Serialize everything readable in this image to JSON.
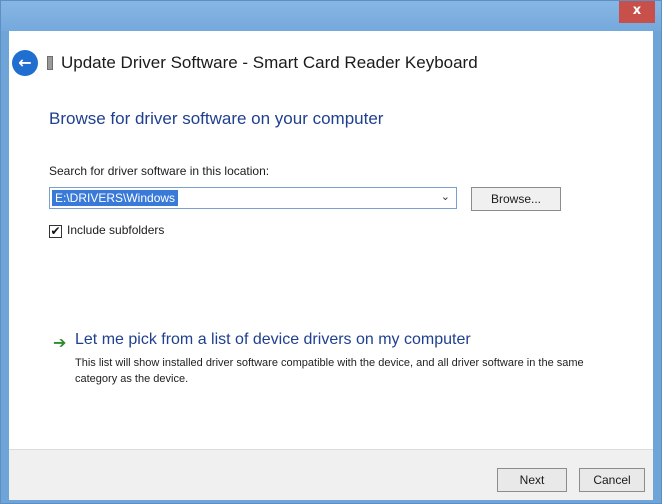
{
  "window": {
    "close_glyph": "x",
    "title": "Update Driver Software - Smart Card Reader Keyboard",
    "back_glyph": "←",
    "icons": {
      "back": "back-arrow-icon",
      "device": "device-icon",
      "close": "close-icon"
    }
  },
  "content": {
    "heading": "Browse for driver software on your computer",
    "search_label": "Search for driver software in this location:",
    "path_value": "E:\\DRIVERS\\Windows",
    "dropdown_glyph": "⌄",
    "browse_label": "Browse...",
    "include_subfolders": {
      "label": "Include subfolders",
      "checked": true,
      "check_glyph": "✔"
    },
    "pick_link": "Let me pick from a list of device drivers on my computer",
    "pick_arrow_glyph": "➔",
    "pick_description": "This list will show installed driver software compatible with the device, and all driver software in the same category as the device."
  },
  "footer": {
    "next_label": "Next",
    "cancel_label": "Cancel"
  },
  "colors": {
    "frame": "#6fa4d8",
    "heading": "#1f3f8f",
    "selection": "#3979d7",
    "close": "#c7504a",
    "arrow_green": "#2e8b2e"
  }
}
